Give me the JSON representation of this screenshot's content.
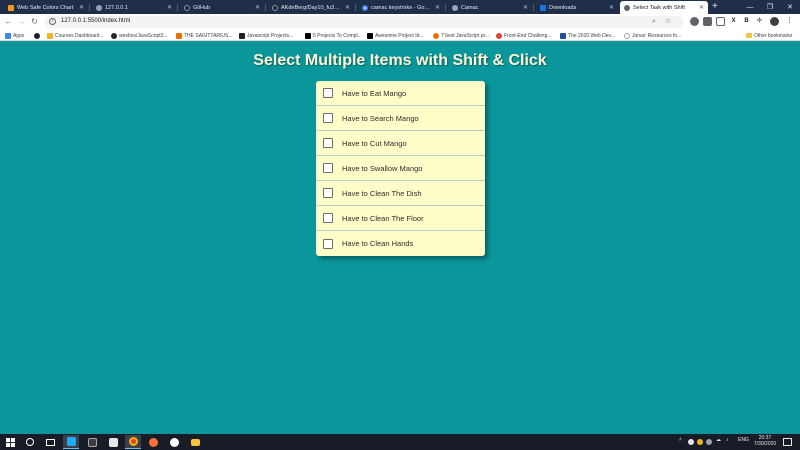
{
  "browser": {
    "tabs": [
      {
        "label": "Web Safe Colors Chart",
        "favicon_color": "#f39c12"
      },
      {
        "label": "127.0.0.1",
        "favicon_color": "#9aa4b5"
      },
      {
        "label": "GitHub",
        "favicon_color": "#24292e"
      },
      {
        "label": "AKdeBerg/Day10_fu30_Sele",
        "favicon_color": "#24292e"
      },
      {
        "label": "camac keystroke - Google S",
        "favicon_color": "#4285f4"
      },
      {
        "label": "Camac",
        "favicon_color": "#9aa4b5"
      },
      {
        "label": "Downloads",
        "favicon_color": "#1a73e8"
      },
      {
        "label": "Select Task with Shift",
        "favicon_color": "#5f6368"
      }
    ],
    "new_tab_label": "+",
    "window_controls": {
      "minimize": "—",
      "maximize": "❐",
      "close": "✕"
    },
    "url": "127.0.0.1:5500/index.html",
    "nav": {
      "back": "←",
      "forward": "→",
      "reload": "↻"
    },
    "bookmarks": [
      {
        "label": "Apps",
        "icon": "apps-grid-icon"
      },
      {
        "label": "",
        "icon": "globe-icon"
      },
      {
        "label": "Courses Dashboard...",
        "icon": "courses-icon"
      },
      {
        "label": "wesbos/JavaScript3...",
        "icon": "github-icon"
      },
      {
        "label": "THE SAGITTARIUS...",
        "icon": "sagittarius-icon"
      },
      {
        "label": "Javascript Projects...",
        "icon": "dev-icon"
      },
      {
        "label": "5 Projects To Compl...",
        "icon": "medium-icon"
      },
      {
        "label": "Awesome Project Id...",
        "icon": "medium-icon"
      },
      {
        "label": "7 best JavaScript pr...",
        "icon": "flame-icon"
      },
      {
        "label": "Front-End Challeng...",
        "icon": "chrome-icon"
      },
      {
        "label": "The 2020 Web Dev...",
        "icon": "web-dev-icon"
      },
      {
        "label": "Jonas' Resources fo...",
        "icon": "resources-icon"
      }
    ],
    "other_bookmarks": "Other bookmarks"
  },
  "page": {
    "title": "Select Multiple Items with Shift & Click",
    "items": [
      {
        "label": "Have to Eat Mango",
        "checked": false
      },
      {
        "label": "Have to Search Mango",
        "checked": false
      },
      {
        "label": "Have to Cut Mango",
        "checked": false
      },
      {
        "label": "Have to Swallow Mango",
        "checked": false
      },
      {
        "label": "Have to Clean The Dish",
        "checked": false
      },
      {
        "label": "Have to Clean The Floor",
        "checked": false
      },
      {
        "label": "Have to Clean Hands",
        "checked": false
      }
    ]
  },
  "taskbar": {
    "language": "ENG",
    "time": "20:37",
    "date": "7/30/2020"
  },
  "colors": {
    "page_background": "#0a969b",
    "list_background": "#fffdc8",
    "title_color": "#fff6d5",
    "tab_strip": "#1f2f4a",
    "taskbar": "#181c26"
  }
}
